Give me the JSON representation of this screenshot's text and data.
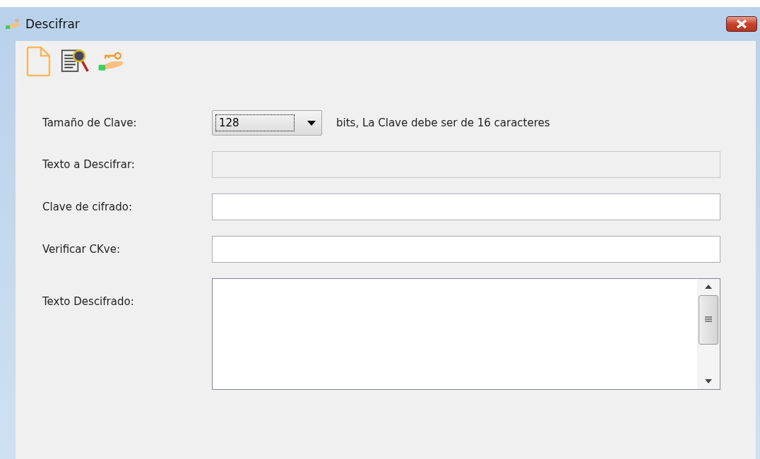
{
  "window": {
    "title": "Descifrar"
  },
  "toolbar": [
    {
      "kind": "new"
    },
    {
      "kind": "inspect"
    },
    {
      "kind": "key"
    }
  ],
  "fields": [
    {
      "kind": "select",
      "label": "Tamaño de Clave:",
      "value": "128",
      "note": "bits, La Clave debe ser de 16 caracteres"
    },
    {
      "kind": "text",
      "label": "Texto a Descifrar:",
      "disabled": true
    },
    {
      "kind": "text",
      "label": "Clave de cifrado:",
      "disabled": false
    },
    {
      "kind": "text",
      "label": "Verificar CKve:",
      "disabled": false
    },
    {
      "kind": "textarea",
      "label": "Texto Descifrado:"
    }
  ]
}
